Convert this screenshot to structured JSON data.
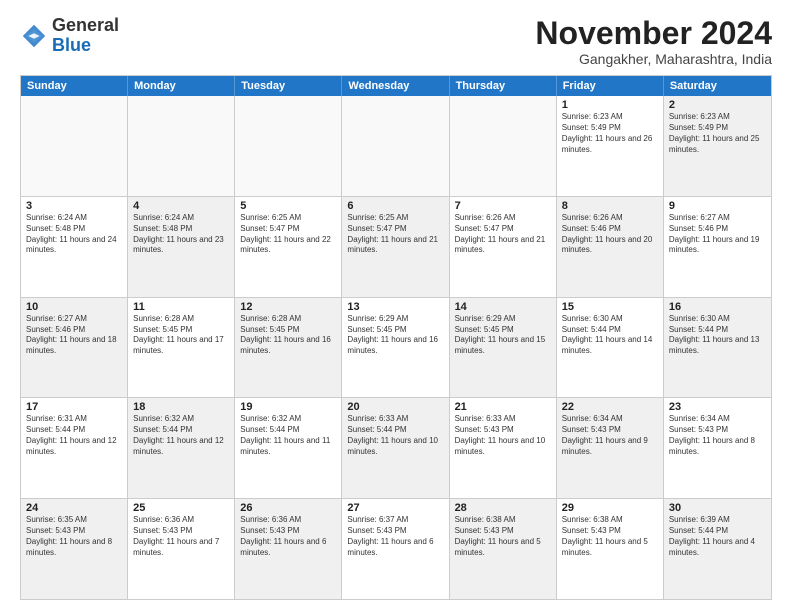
{
  "logo": {
    "general": "General",
    "blue": "Blue"
  },
  "title": "November 2024",
  "location": "Gangakher, Maharashtra, India",
  "days_of_week": [
    "Sunday",
    "Monday",
    "Tuesday",
    "Wednesday",
    "Thursday",
    "Friday",
    "Saturday"
  ],
  "weeks": [
    [
      {
        "day": "",
        "info": "",
        "empty": true
      },
      {
        "day": "",
        "info": "",
        "empty": true
      },
      {
        "day": "",
        "info": "",
        "empty": true
      },
      {
        "day": "",
        "info": "",
        "empty": true
      },
      {
        "day": "",
        "info": "",
        "empty": true
      },
      {
        "day": "1",
        "info": "Sunrise: 6:23 AM\nSunset: 5:49 PM\nDaylight: 11 hours and 26 minutes.",
        "shade": false
      },
      {
        "day": "2",
        "info": "Sunrise: 6:23 AM\nSunset: 5:49 PM\nDaylight: 11 hours and 25 minutes.",
        "shade": true
      }
    ],
    [
      {
        "day": "3",
        "info": "Sunrise: 6:24 AM\nSunset: 5:48 PM\nDaylight: 11 hours and 24 minutes.",
        "shade": false
      },
      {
        "day": "4",
        "info": "Sunrise: 6:24 AM\nSunset: 5:48 PM\nDaylight: 11 hours and 23 minutes.",
        "shade": true
      },
      {
        "day": "5",
        "info": "Sunrise: 6:25 AM\nSunset: 5:47 PM\nDaylight: 11 hours and 22 minutes.",
        "shade": false
      },
      {
        "day": "6",
        "info": "Sunrise: 6:25 AM\nSunset: 5:47 PM\nDaylight: 11 hours and 21 minutes.",
        "shade": true
      },
      {
        "day": "7",
        "info": "Sunrise: 6:26 AM\nSunset: 5:47 PM\nDaylight: 11 hours and 21 minutes.",
        "shade": false
      },
      {
        "day": "8",
        "info": "Sunrise: 6:26 AM\nSunset: 5:46 PM\nDaylight: 11 hours and 20 minutes.",
        "shade": true
      },
      {
        "day": "9",
        "info": "Sunrise: 6:27 AM\nSunset: 5:46 PM\nDaylight: 11 hours and 19 minutes.",
        "shade": false
      }
    ],
    [
      {
        "day": "10",
        "info": "Sunrise: 6:27 AM\nSunset: 5:46 PM\nDaylight: 11 hours and 18 minutes.",
        "shade": true
      },
      {
        "day": "11",
        "info": "Sunrise: 6:28 AM\nSunset: 5:45 PM\nDaylight: 11 hours and 17 minutes.",
        "shade": false
      },
      {
        "day": "12",
        "info": "Sunrise: 6:28 AM\nSunset: 5:45 PM\nDaylight: 11 hours and 16 minutes.",
        "shade": true
      },
      {
        "day": "13",
        "info": "Sunrise: 6:29 AM\nSunset: 5:45 PM\nDaylight: 11 hours and 16 minutes.",
        "shade": false
      },
      {
        "day": "14",
        "info": "Sunrise: 6:29 AM\nSunset: 5:45 PM\nDaylight: 11 hours and 15 minutes.",
        "shade": true
      },
      {
        "day": "15",
        "info": "Sunrise: 6:30 AM\nSunset: 5:44 PM\nDaylight: 11 hours and 14 minutes.",
        "shade": false
      },
      {
        "day": "16",
        "info": "Sunrise: 6:30 AM\nSunset: 5:44 PM\nDaylight: 11 hours and 13 minutes.",
        "shade": true
      }
    ],
    [
      {
        "day": "17",
        "info": "Sunrise: 6:31 AM\nSunset: 5:44 PM\nDaylight: 11 hours and 12 minutes.",
        "shade": false
      },
      {
        "day": "18",
        "info": "Sunrise: 6:32 AM\nSunset: 5:44 PM\nDaylight: 11 hours and 12 minutes.",
        "shade": true
      },
      {
        "day": "19",
        "info": "Sunrise: 6:32 AM\nSunset: 5:44 PM\nDaylight: 11 hours and 11 minutes.",
        "shade": false
      },
      {
        "day": "20",
        "info": "Sunrise: 6:33 AM\nSunset: 5:44 PM\nDaylight: 11 hours and 10 minutes.",
        "shade": true
      },
      {
        "day": "21",
        "info": "Sunrise: 6:33 AM\nSunset: 5:43 PM\nDaylight: 11 hours and 10 minutes.",
        "shade": false
      },
      {
        "day": "22",
        "info": "Sunrise: 6:34 AM\nSunset: 5:43 PM\nDaylight: 11 hours and 9 minutes.",
        "shade": true
      },
      {
        "day": "23",
        "info": "Sunrise: 6:34 AM\nSunset: 5:43 PM\nDaylight: 11 hours and 8 minutes.",
        "shade": false
      }
    ],
    [
      {
        "day": "24",
        "info": "Sunrise: 6:35 AM\nSunset: 5:43 PM\nDaylight: 11 hours and 8 minutes.",
        "shade": true
      },
      {
        "day": "25",
        "info": "Sunrise: 6:36 AM\nSunset: 5:43 PM\nDaylight: 11 hours and 7 minutes.",
        "shade": false
      },
      {
        "day": "26",
        "info": "Sunrise: 6:36 AM\nSunset: 5:43 PM\nDaylight: 11 hours and 6 minutes.",
        "shade": true
      },
      {
        "day": "27",
        "info": "Sunrise: 6:37 AM\nSunset: 5:43 PM\nDaylight: 11 hours and 6 minutes.",
        "shade": false
      },
      {
        "day": "28",
        "info": "Sunrise: 6:38 AM\nSunset: 5:43 PM\nDaylight: 11 hours and 5 minutes.",
        "shade": true
      },
      {
        "day": "29",
        "info": "Sunrise: 6:38 AM\nSunset: 5:43 PM\nDaylight: 11 hours and 5 minutes.",
        "shade": false
      },
      {
        "day": "30",
        "info": "Sunrise: 6:39 AM\nSunset: 5:44 PM\nDaylight: 11 hours and 4 minutes.",
        "shade": true
      }
    ]
  ]
}
